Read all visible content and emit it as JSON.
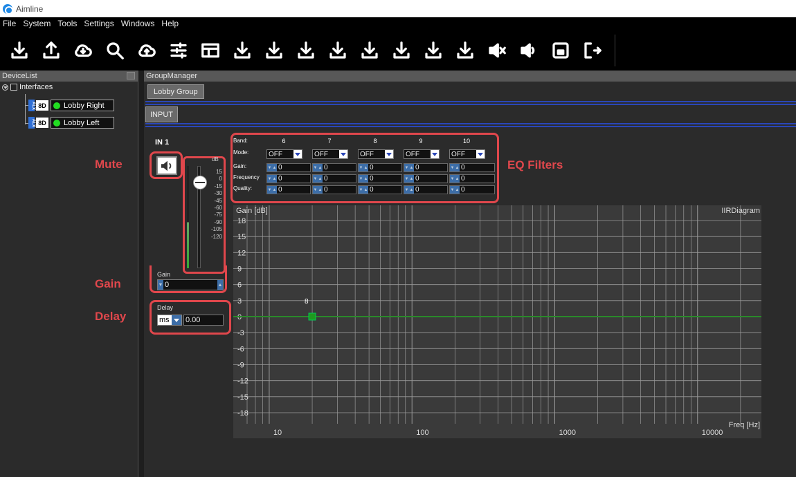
{
  "app": {
    "title": "Aimline"
  },
  "menu": [
    "File",
    "System",
    "Tools",
    "Settings",
    "Windows",
    "Help"
  ],
  "toolbar": {
    "buttons": [
      {
        "icon": "download-icon"
      },
      {
        "icon": "upload-icon"
      },
      {
        "icon": "cloud-download-icon"
      },
      {
        "icon": "search-icon"
      },
      {
        "icon": "cloud-upload-icon"
      },
      {
        "icon": "sliders-icon"
      },
      {
        "icon": "layout-icon"
      },
      {
        "icon": "download-icon"
      },
      {
        "icon": "download-icon"
      },
      {
        "icon": "download-icon"
      },
      {
        "icon": "download-icon"
      },
      {
        "icon": "download-icon"
      },
      {
        "icon": "download-icon"
      },
      {
        "icon": "download-icon"
      },
      {
        "icon": "download-icon"
      },
      {
        "icon": "mute-speaker-icon"
      },
      {
        "icon": "speaker-icon"
      },
      {
        "icon": "save-icon"
      },
      {
        "icon": "exit-icon"
      }
    ]
  },
  "sidebar": {
    "title": "DeviceList",
    "root": "Interfaces",
    "devices": [
      {
        "badge": "8D",
        "side": "ALX",
        "name": "Lobby Right",
        "status_color": "#22dd22"
      },
      {
        "badge": "8D",
        "side": "ALX",
        "name": "Lobby Left",
        "status_color": "#22dd22"
      }
    ]
  },
  "main": {
    "title": "GroupManager",
    "group_tab": "Lobby Group",
    "input_tab": "INPUT",
    "channel": "IN 1",
    "fader": {
      "unit": "dB",
      "ticks": [
        "15",
        "0",
        "-15",
        "-30",
        "-45",
        "-60",
        "-75",
        "-90",
        "-105",
        "-120"
      ]
    },
    "gain": {
      "label": "Gain",
      "value": "0"
    },
    "delay": {
      "label": "Delay",
      "unit": "ms",
      "value": "0.00"
    },
    "annotations": {
      "mute": "Mute",
      "gain": "Gain",
      "delay": "Delay",
      "eq": "EQ Filters"
    },
    "eq": {
      "row_labels": {
        "band": "Band:",
        "mode": "Mode:",
        "gain": "Gain:",
        "frequency": "Frequency",
        "quality": "Quality:"
      },
      "bands": [
        {
          "band": "6",
          "mode": "OFF",
          "gain": "0",
          "frequency": "0",
          "quality": "0"
        },
        {
          "band": "7",
          "mode": "OFF",
          "gain": "0",
          "frequency": "0",
          "quality": "0"
        },
        {
          "band": "8",
          "mode": "OFF",
          "gain": "0",
          "frequency": "0",
          "quality": "0"
        },
        {
          "band": "9",
          "mode": "OFF",
          "gain": "0",
          "frequency": "0",
          "quality": "0"
        },
        {
          "band": "10",
          "mode": "OFF",
          "gain": "0",
          "frequency": "0",
          "quality": "0"
        }
      ]
    },
    "diagram": {
      "title": "IIRDiagram",
      "y_axis_label": "Gain [dB]",
      "x_axis_label": "Freq [Hz]",
      "y_ticks": [
        "18",
        "15",
        "12",
        "9",
        "6",
        "3",
        "0",
        "-3",
        "-6",
        "-9",
        "-12",
        "-15",
        "-18"
      ],
      "x_ticks": [
        "10",
        "100",
        "1000",
        "10000"
      ],
      "curve_color": "#2a8a2a",
      "marker_label": "8"
    }
  }
}
